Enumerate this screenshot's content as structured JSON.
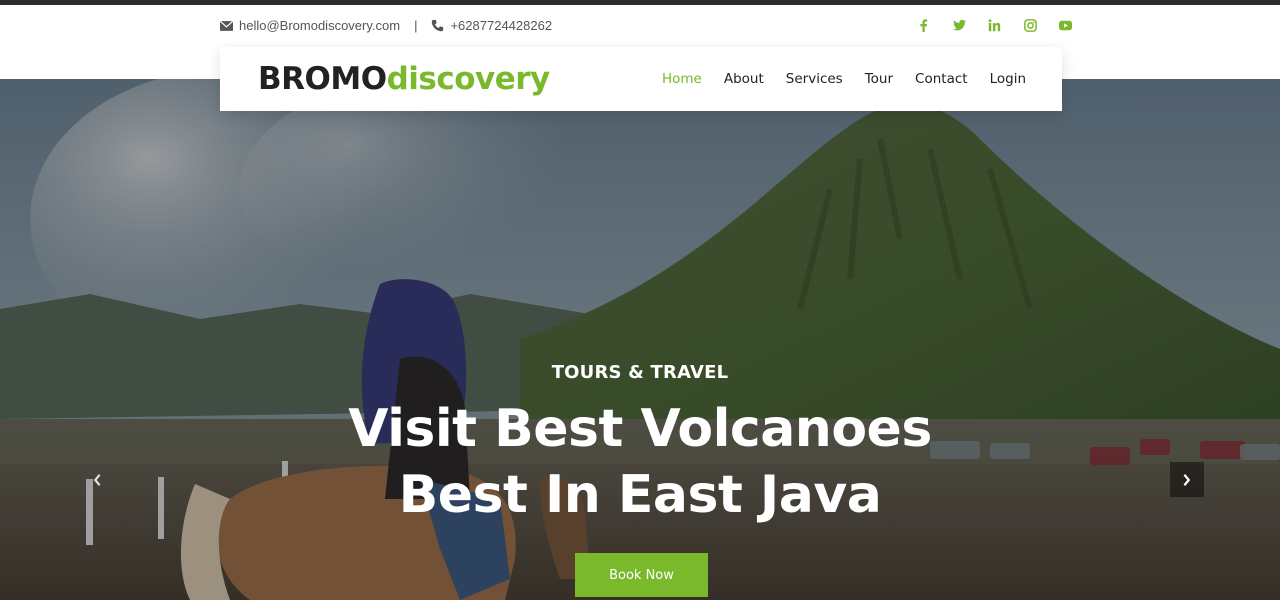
{
  "topbar": {
    "email": "hello@Bromodiscovery.com",
    "separator": "|",
    "phone": "+6287724428262",
    "social": [
      {
        "name": "facebook-icon"
      },
      {
        "name": "twitter-icon"
      },
      {
        "name": "linkedin-icon"
      },
      {
        "name": "instagram-icon"
      },
      {
        "name": "youtube-icon"
      }
    ]
  },
  "brand": {
    "part1": "BROMO",
    "part2": "discovery"
  },
  "nav": {
    "items": [
      {
        "label": "Home",
        "active": true
      },
      {
        "label": "About"
      },
      {
        "label": "Services"
      },
      {
        "label": "Tour"
      },
      {
        "label": "Contact"
      },
      {
        "label": "Login"
      }
    ]
  },
  "hero": {
    "kicker": "TOURS & TRAVEL",
    "title_line1": "Visit Best Volcanoes",
    "title_line2": "Best In East Java",
    "cta": "Book Now"
  },
  "colors": {
    "accent": "#7ab82c",
    "dark": "#222222"
  }
}
